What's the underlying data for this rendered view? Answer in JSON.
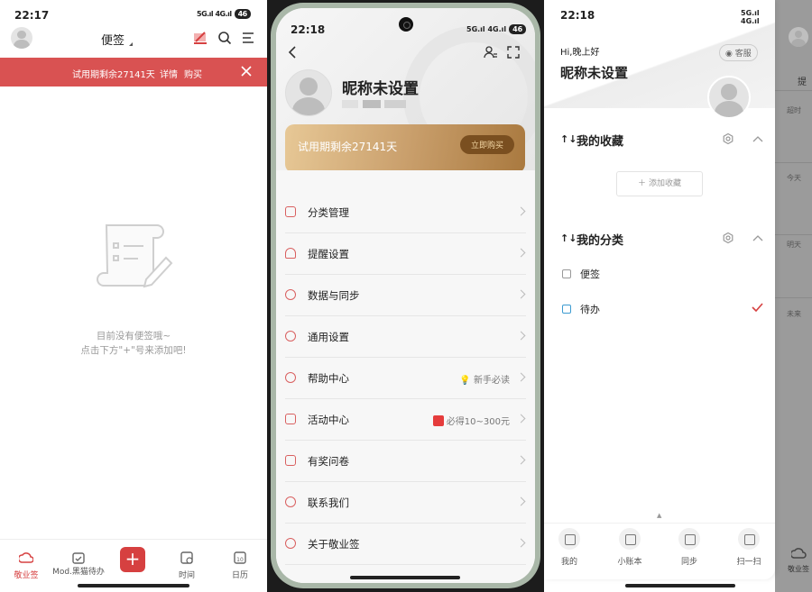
{
  "panel1": {
    "time": "22:17",
    "signal": "5G.ıl 4G.ıl",
    "battery": "46",
    "title": "便签",
    "trial": {
      "text": "试用期剩余27141天",
      "detail": "详情",
      "buy": "购买"
    },
    "empty_line1": "目前没有便签哦~",
    "empty_line2": "点击下方\"+\"号来添加吧!",
    "tabs": [
      {
        "label": "敬业签",
        "icon": "cloud-icon"
      },
      {
        "label": "Mod.黑猫待办",
        "icon": "calendar-check-icon"
      },
      {
        "label": "时间",
        "icon": "clock-calendar-icon"
      },
      {
        "label": "日历",
        "icon": "calendar-icon"
      }
    ],
    "add_label": "+",
    "active_color": "#d64040"
  },
  "panel2": {
    "time": "22:18",
    "signal": "5G.ıl 4G.ıl",
    "battery": "46",
    "nickname": "昵称未设置",
    "trial": "试用期剩余27141天",
    "buy_now": "立即购买",
    "menu": [
      {
        "label": "分类管理",
        "extra": "",
        "icon": "category-icon"
      },
      {
        "label": "提醒设置",
        "extra": "",
        "icon": "bell-icon"
      },
      {
        "label": "数据与同步",
        "extra": "",
        "icon": "sync-icon"
      },
      {
        "label": "通用设置",
        "extra": "",
        "icon": "settings-icon"
      },
      {
        "label": "帮助中心",
        "extra": "新手必读",
        "icon": "help-icon"
      },
      {
        "label": "活动中心",
        "extra": "必得10~300元",
        "icon": "activity-icon"
      },
      {
        "label": "有奖问卷",
        "extra": "",
        "icon": "survey-icon"
      },
      {
        "label": "联系我们",
        "extra": "",
        "icon": "chat-icon"
      },
      {
        "label": "关于敬业签",
        "extra": "",
        "icon": "info-icon"
      }
    ]
  },
  "panel3": {
    "time": "22:18",
    "signal": "5G.ıl 4G.ıl",
    "battery": "46",
    "greeting": "Hi,晚上好",
    "nickname": "昵称未设置",
    "service": "客服",
    "favorites_title": "我的收藏",
    "add_favorite": "添加收藏",
    "categories_title": "我的分类",
    "categories": [
      {
        "label": "便签",
        "checked": false
      },
      {
        "label": "待办",
        "checked": true
      }
    ],
    "bottom": [
      {
        "label": "我的"
      },
      {
        "label": "小账本"
      },
      {
        "label": "同步"
      },
      {
        "label": "扫一扫"
      }
    ],
    "side_labels": [
      "提",
      "超时",
      "今天",
      "明天",
      "未来"
    ],
    "side_tab": "敬业签"
  }
}
